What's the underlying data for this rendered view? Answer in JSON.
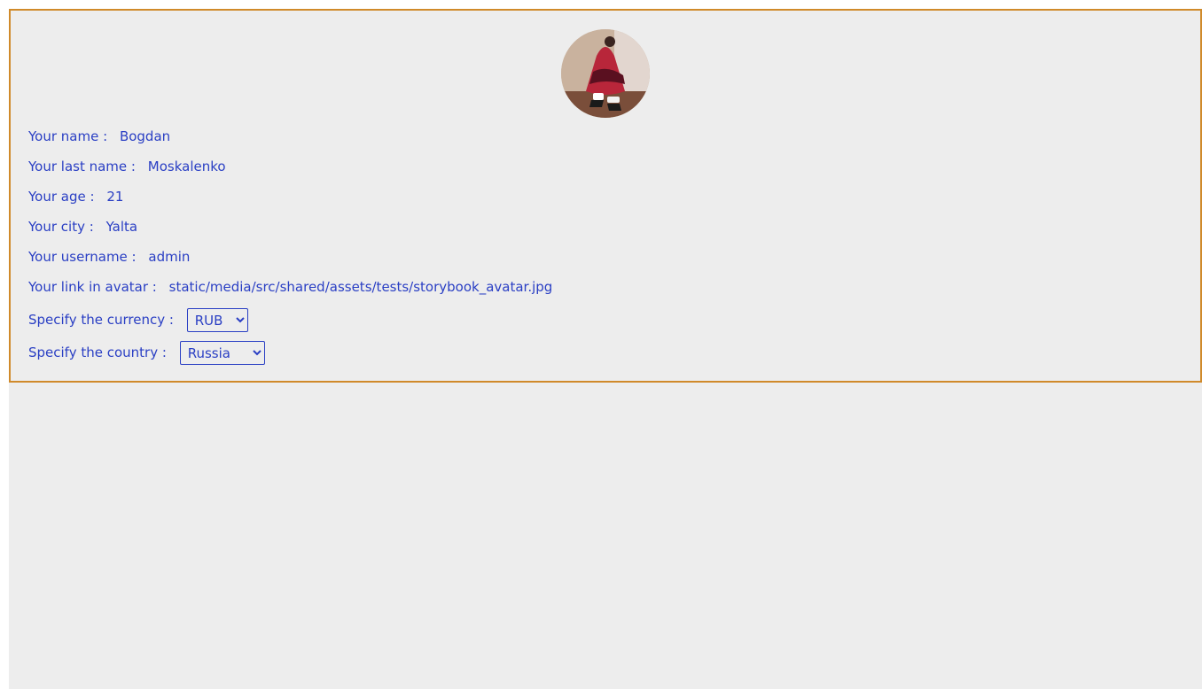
{
  "profile": {
    "avatar_alt": "avatar",
    "fields": [
      {
        "label": "Your name :",
        "value": "Bogdan"
      },
      {
        "label": "Your last name :",
        "value": "Moskalenko"
      },
      {
        "label": "Your age :",
        "value": "21"
      },
      {
        "label": "Your city :",
        "value": "Yalta"
      },
      {
        "label": "Your username :",
        "value": "admin"
      },
      {
        "label": "Your link in avatar :",
        "value": "static/media/src/shared/assets/tests/storybook_avatar.jpg"
      }
    ],
    "currency": {
      "label": "Specify the currency :",
      "selected": "RUB"
    },
    "country": {
      "label": "Specify the country :",
      "selected": "Russia"
    }
  },
  "colors": {
    "text": "#2a3fc4",
    "card_border": "#d08a2a",
    "background": "#ededed"
  }
}
